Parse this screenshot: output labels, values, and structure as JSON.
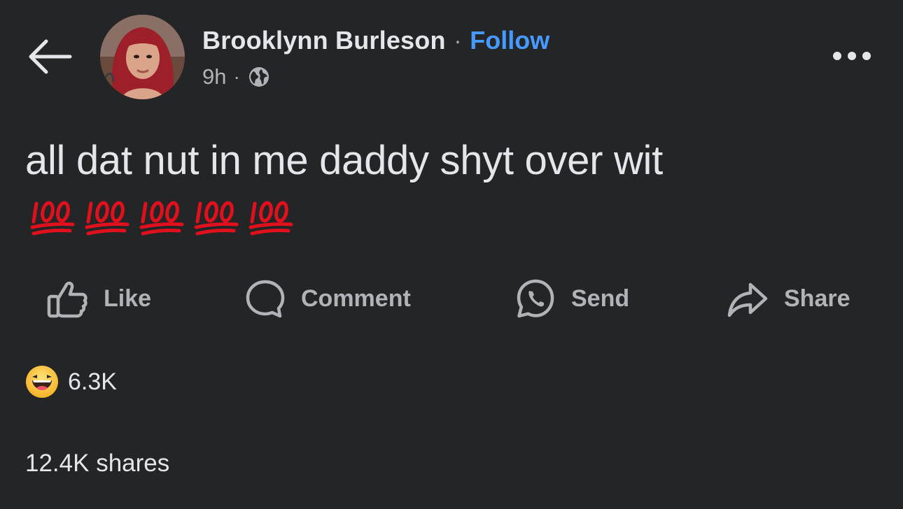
{
  "header": {
    "back_icon": "arrow-left-icon",
    "author_name": "Brooklynn Burleson",
    "separator": "·",
    "follow_label": "Follow",
    "time": "9h",
    "meta_separator": "·",
    "audience_icon": "globe-icon",
    "more_icon": "more-horizontal-icon"
  },
  "post": {
    "text": "all dat nut in me daddy shyt over wit",
    "emoji": [
      "hundred-points-emoji",
      "hundred-points-emoji",
      "hundred-points-emoji",
      "hundred-points-emoji",
      "hundred-points-emoji"
    ]
  },
  "actions": {
    "like_label": "Like",
    "comment_label": "Comment",
    "send_label": "Send",
    "share_label": "Share"
  },
  "engagement": {
    "reaction_icon": "haha-reaction-icon",
    "reaction_count": "6.3K",
    "shares": "12.4K shares"
  },
  "colors": {
    "background": "#242526",
    "primary_text": "#e4e6eb",
    "secondary_text": "#b0b3b8",
    "accent": "#4599ff",
    "emoji_red": "#e0101c"
  }
}
